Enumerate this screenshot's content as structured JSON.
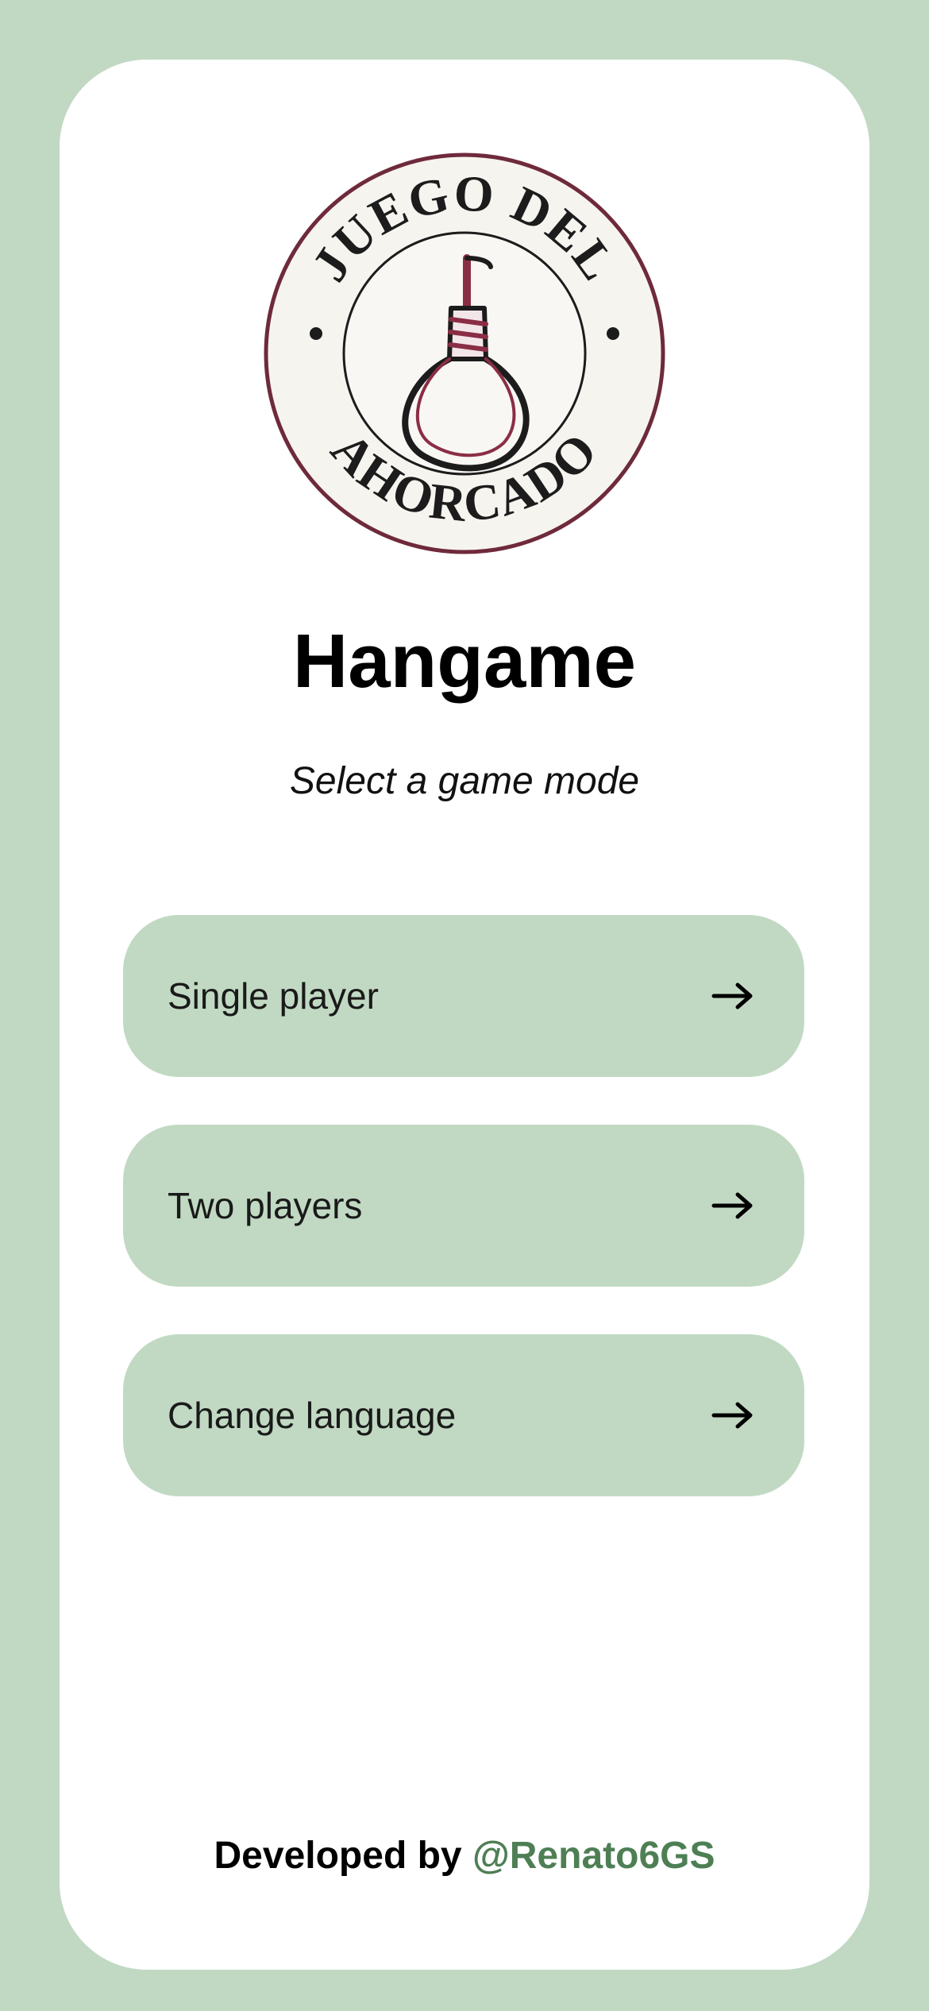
{
  "logo": {
    "top_text": "JUEGO DEL",
    "bottom_text": "AHORCADO"
  },
  "header": {
    "title": "Hangame",
    "subtitle": "Select a game mode"
  },
  "menu": {
    "items": [
      {
        "label": "Single player",
        "icon": "arrow-right-icon"
      },
      {
        "label": "Two players",
        "icon": "arrow-right-icon"
      },
      {
        "label": "Change language",
        "icon": "arrow-right-icon"
      }
    ]
  },
  "footer": {
    "prefix": "Developed by",
    "handle": "@Renato6GS"
  },
  "colors": {
    "background": "#c1d9c3",
    "card": "#ffffff",
    "button": "#c1d9c3",
    "handle": "#4e7f54",
    "logo_ring": "#6e2a3b"
  }
}
